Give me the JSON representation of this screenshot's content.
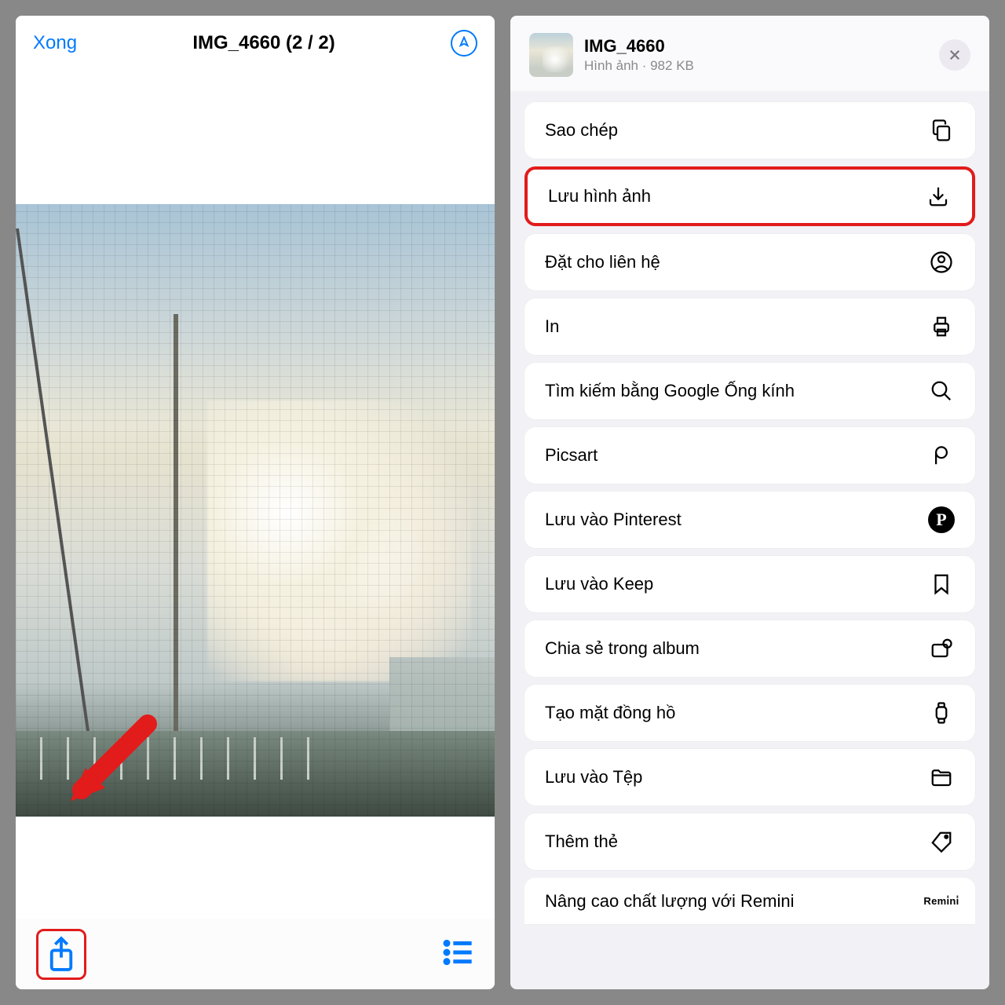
{
  "left": {
    "done": "Xong",
    "title": "IMG_4660 (2 / 2)"
  },
  "sheet": {
    "title": "IMG_4660",
    "subtitle": "Hình ảnh · 982 KB"
  },
  "actions": {
    "copy": "Sao chép",
    "save_image": "Lưu hình ảnh",
    "assign_contact": "Đặt cho liên hệ",
    "print": "In",
    "google_lens": "Tìm kiếm bằng Google Ống kính",
    "picsart": "Picsart",
    "pinterest": "Lưu vào Pinterest",
    "keep": "Lưu vào Keep",
    "share_album": "Chia sẻ trong album",
    "watch_face": "Tạo mặt đồng hồ",
    "save_files": "Lưu vào Tệp",
    "add_tags": "Thêm thẻ",
    "remini": "Nâng cao chất lượng với Remini"
  }
}
